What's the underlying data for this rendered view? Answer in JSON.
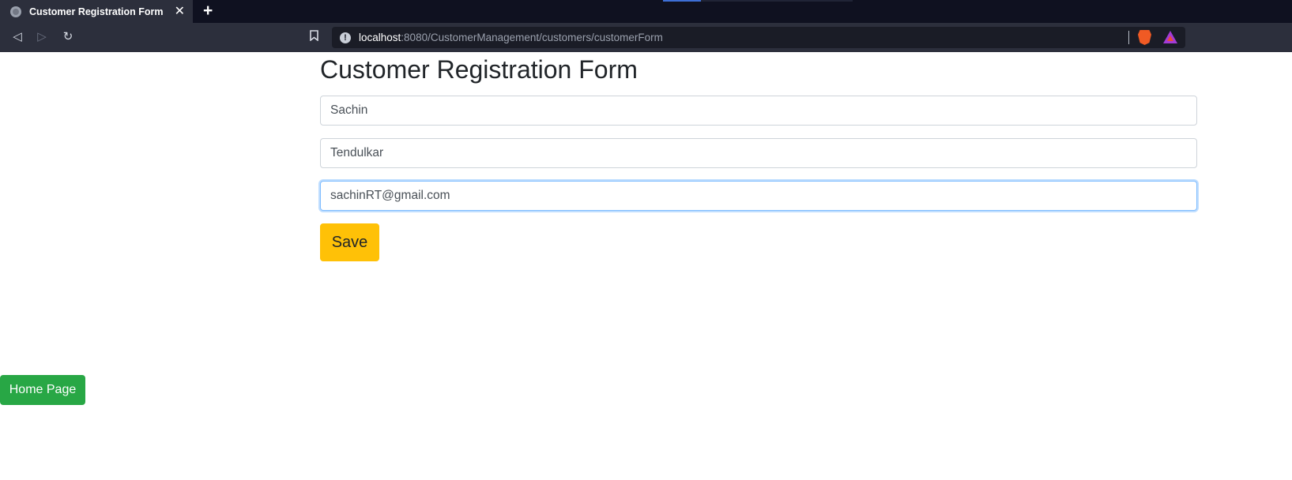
{
  "browser": {
    "tab_title": "Customer Registration Form",
    "tab_close": "✕",
    "new_tab": "+",
    "url_host": "localhost",
    "url_path": ":8080/CustomerManagement/customers/customerForm",
    "url_info_glyph": "!",
    "back_glyph": "◁",
    "forward_glyph": "▷",
    "reload_glyph": "↻",
    "bookmark_glyph": "🔖"
  },
  "page": {
    "title": "Customer Registration Form"
  },
  "form": {
    "first_name_value": "Sachin",
    "last_name_value": "Tendulkar",
    "email_value": "sachinRT@gmail.com",
    "save_label": "Save"
  },
  "footer": {
    "home_label": "Home Page"
  },
  "colors": {
    "save_button": "#ffc107",
    "home_button": "#28a745",
    "focus_border": "#80bdff"
  },
  "icons": {
    "tab_favicon": "globe-icon",
    "back": "back-icon",
    "forward": "forward-icon",
    "reload": "reload-icon",
    "bookmark": "bookmark-icon",
    "site_info": "info-icon",
    "brave_shields": "brave-shields-icon",
    "brave_rewards": "brave-rewards-icon"
  }
}
